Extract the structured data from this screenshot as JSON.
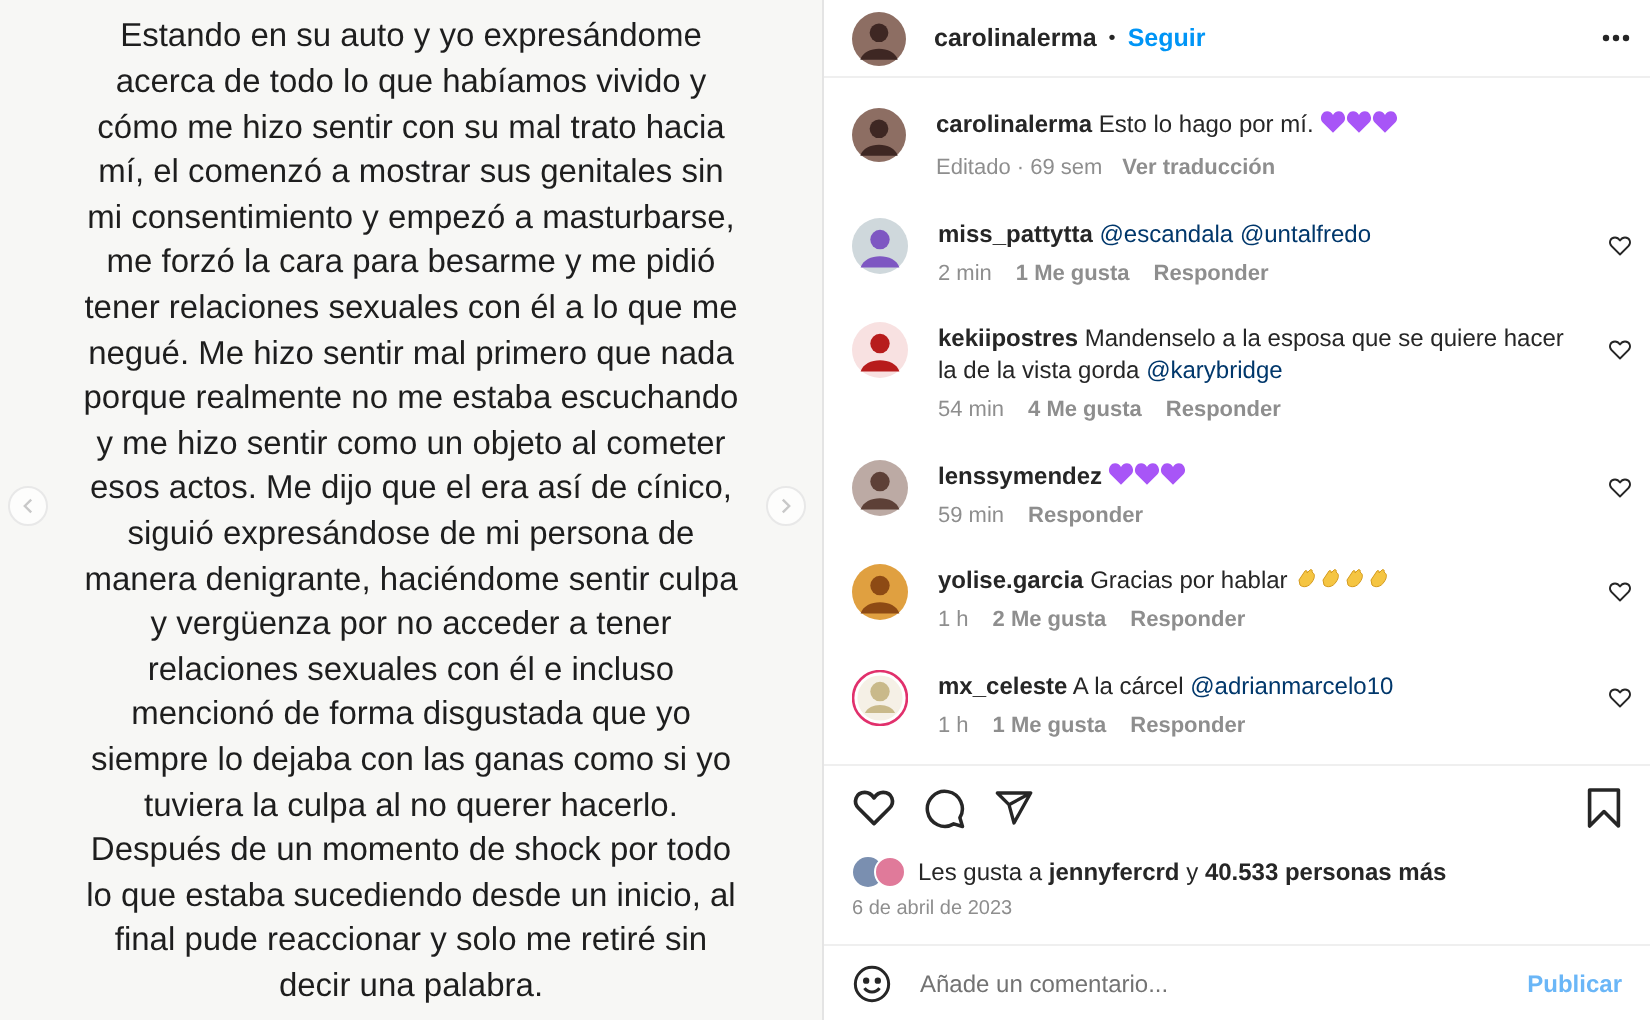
{
  "post_text": [
    "Estando en su auto y yo expresándome",
    "acerca de todo lo que habíamos vivido y",
    "cómo me hizo sentir con su mal trato hacia",
    "mí, el comenzó a mostrar sus genitales sin",
    "mi consentimiento y empezó a masturbarse,",
    "me forzó la cara para besarme y me pidió",
    "tener relaciones sexuales con él a lo que me",
    "negué. Me hizo sentir mal primero que nada",
    "porque realmente no me estaba escuchando",
    "y me hizo sentir como un objeto al cometer",
    "esos actos. Me dijo que el era así de cínico,",
    "siguió expresándose de mi persona de",
    "manera denigrante, haciéndome sentir culpa",
    "y vergüenza por no acceder a tener",
    "relaciones sexuales con él e incluso",
    "mencionó de forma disgustada que yo",
    "siempre lo dejaba con las ganas como si yo",
    "tuviera la culpa al no querer hacerlo.",
    "Después de un momento de shock por todo",
    "lo que estaba sucediendo desde un inicio, al",
    "final pude reaccionar y solo me retiré sin",
    "decir una palabra."
  ],
  "header": {
    "username": "carolinalerma",
    "separator": "•",
    "follow": "Seguir"
  },
  "caption": {
    "username": "carolinalerma",
    "text": "Esto lo hago por mí.",
    "emojis": [
      {
        "kind": "heart"
      },
      {
        "kind": "heart"
      },
      {
        "kind": "heart"
      }
    ],
    "meta": "Editado · 69 sem",
    "translate": "Ver traducción"
  },
  "comments": [
    {
      "username": "miss_pattytta",
      "parts": [
        {
          "kind": "mention",
          "text": "@escandala"
        },
        {
          "kind": "mention",
          "text": "@untalfredo"
        }
      ],
      "time": "2 min",
      "likes": "1 Me gusta",
      "reply": "Responder",
      "story": false
    },
    {
      "username": "kekiipostres",
      "parts": [
        {
          "kind": "text",
          "text": "Mandenselo a la esposa que se quiere hacer la de la vista gorda"
        },
        {
          "kind": "mention",
          "text": "@karybridge"
        }
      ],
      "time": "54 min",
      "likes": "4 Me gusta",
      "reply": "Responder",
      "story": false
    },
    {
      "username": "lenssymendez",
      "emojis": [
        {
          "kind": "heart"
        },
        {
          "kind": "heart"
        },
        {
          "kind": "heart"
        }
      ],
      "time": "59 min",
      "reply": "Responder",
      "story": false
    },
    {
      "username": "yolise.garcia",
      "parts": [
        {
          "kind": "text",
          "text": "Gracias por hablar"
        }
      ],
      "emojis": [
        {
          "kind": "clap"
        },
        {
          "kind": "clap"
        },
        {
          "kind": "clap"
        },
        {
          "kind": "clap"
        }
      ],
      "time": "1 h",
      "likes": "2 Me gusta",
      "reply": "Responder",
      "story": false
    },
    {
      "username": "mx_celeste",
      "parts": [
        {
          "kind": "text",
          "text": "A la cárcel"
        },
        {
          "kind": "mention",
          "text": "@adrianmarcelo10"
        }
      ],
      "time": "1 h",
      "likes": "1 Me gusta",
      "reply": "Responder",
      "story": true
    }
  ],
  "likes": {
    "prefix": "Les gusta a",
    "user": "jennyfercrd",
    "joiner": "y",
    "rest": "40.533 personas más"
  },
  "date": "6 de abril de 2023",
  "comment_box": {
    "placeholder": "Añade un comentario...",
    "submit": "Publicar"
  }
}
